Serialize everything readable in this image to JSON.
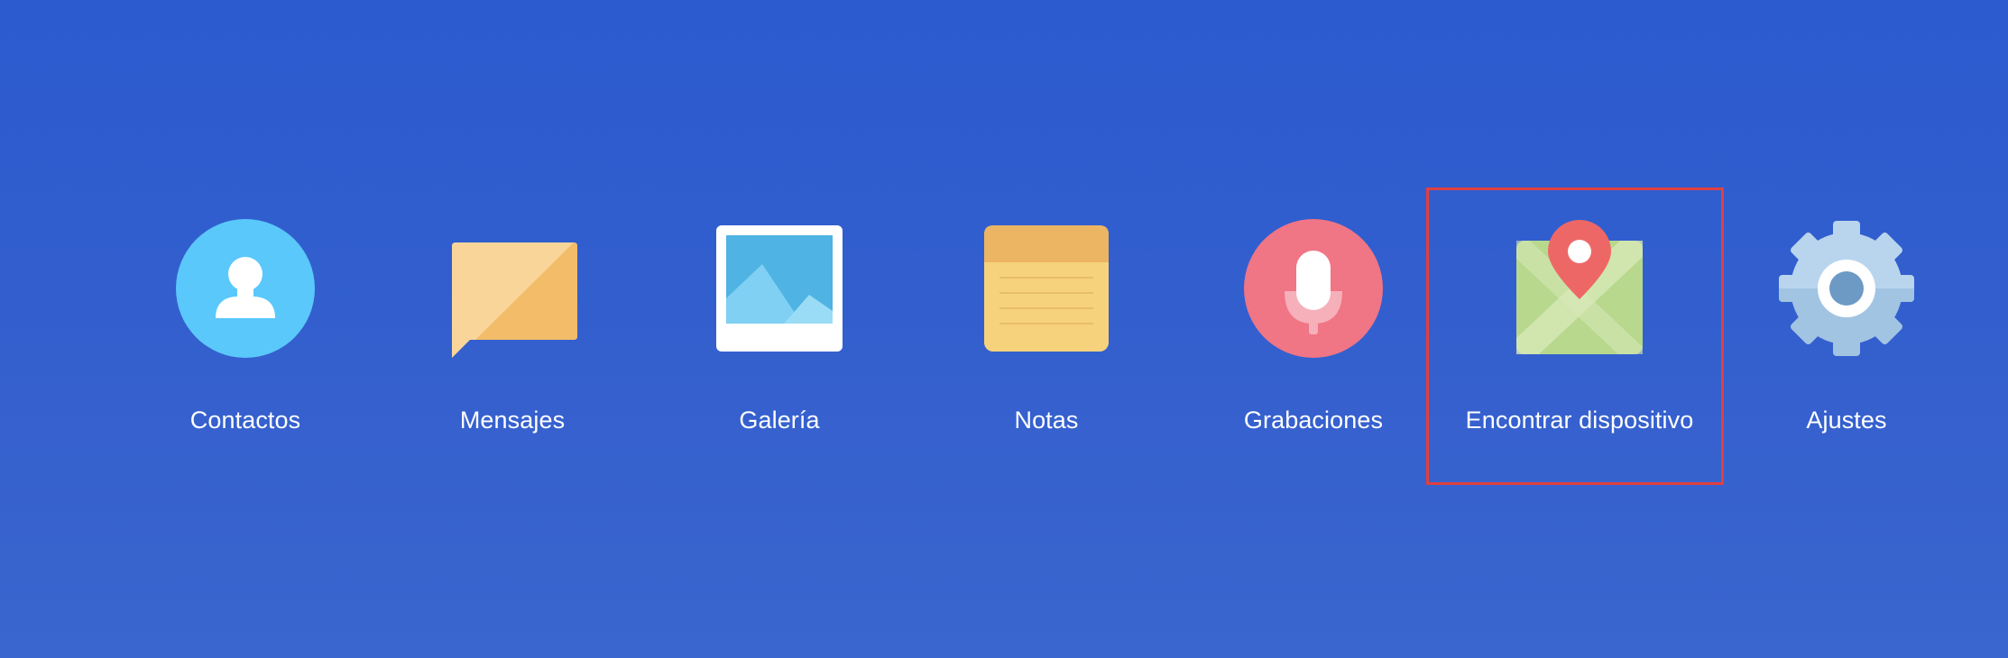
{
  "apps": [
    {
      "id": "contactos",
      "label": "Contactos",
      "icon": "contacts-icon"
    },
    {
      "id": "mensajes",
      "label": "Mensajes",
      "icon": "messages-icon"
    },
    {
      "id": "galeria",
      "label": "Galería",
      "icon": "gallery-icon"
    },
    {
      "id": "notas",
      "label": "Notas",
      "icon": "notes-icon"
    },
    {
      "id": "grabaciones",
      "label": "Grabaciones",
      "icon": "microphone-icon"
    },
    {
      "id": "encontrar",
      "label": "Encontrar dispositivo",
      "icon": "map-pin-icon",
      "selected": true
    },
    {
      "id": "ajustes",
      "label": "Ajustes",
      "icon": "gear-icon"
    }
  ],
  "colors": {
    "background": "#2b5bcf",
    "selection_border": "#e04040",
    "label_text": "#ffffff"
  }
}
